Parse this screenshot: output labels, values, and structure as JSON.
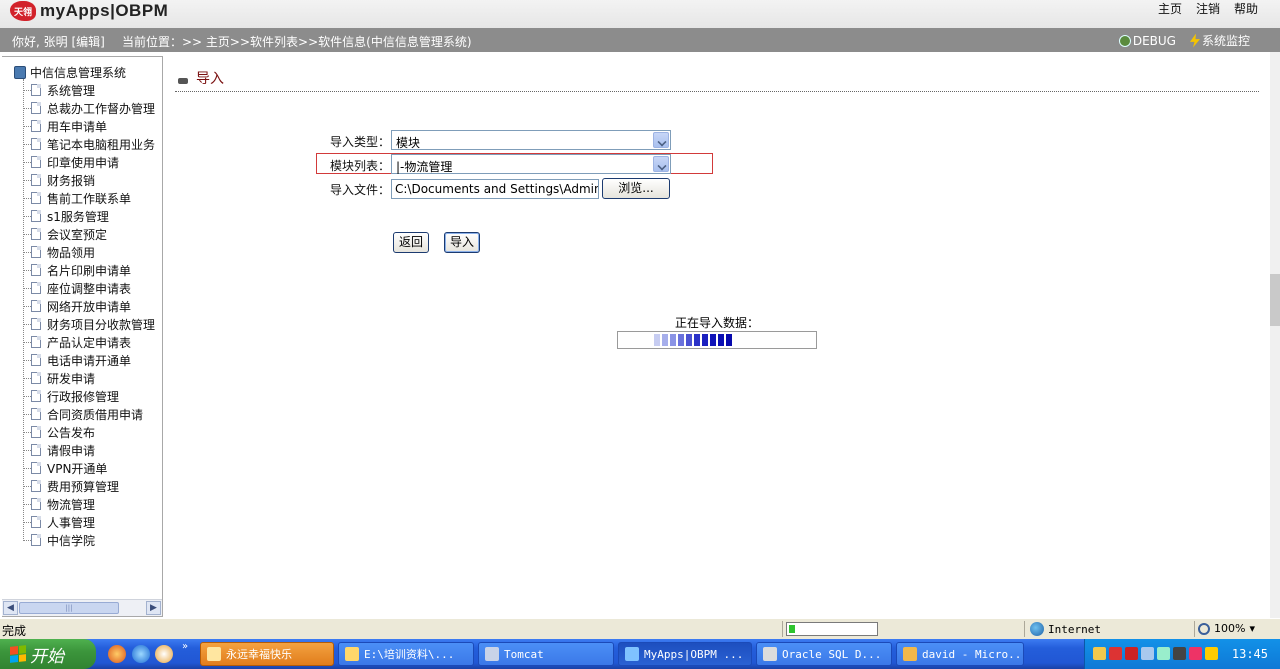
{
  "app": {
    "logo_mark": "天翎",
    "title": "myApps|OBPM",
    "top_links": [
      "主页",
      "注销",
      "帮助"
    ]
  },
  "infobar": {
    "greeting": "你好, 张明 [编辑]",
    "breadcrumb": "当前位置：>> 主页>>软件列表>>软件信息(中信信息管理系统)",
    "debug_label": "DEBUG",
    "monitor_label": "系统监控"
  },
  "sidebar": {
    "root": "中信信息管理系统",
    "items": [
      "系统管理",
      "总裁办工作督办管理",
      "用车申请单",
      "笔记本电脑租用业务",
      "印章使用申请",
      "财务报销",
      "售前工作联系单",
      "s1服务管理",
      "会议室预定",
      "物品领用",
      "名片印刷申请单",
      "座位调整申请表",
      "网络开放申请单",
      "财务项目分收款管理",
      "产品认定申请表",
      "电话申请开通单",
      "研发申请",
      "行政报修管理",
      "合同资质借用申请",
      "公告发布",
      "请假申请",
      "VPN开通单",
      "费用预算管理",
      "物流管理",
      "人事管理",
      "中信学院"
    ]
  },
  "main": {
    "title": "导入",
    "import_type_label": "导入类型：",
    "import_type_value": "模块",
    "module_list_label": "模块列表：",
    "module_list_value": "|-物流管理",
    "import_file_label": "导入文件：",
    "import_file_value": "C:\\Documents and Settings\\Admini",
    "browse_button": "浏览...",
    "back_button": "返回",
    "import_button": "导入",
    "progress_label": "正在导入数据：",
    "progress_colors": [
      "#c7cdf2",
      "#a6aeeb",
      "#8a93e5",
      "#6a72dc",
      "#4b52d2",
      "#2b32c8",
      "#1a1fbf",
      "#1014b9",
      "#0a0eb3",
      "#0709ad"
    ]
  },
  "statusbar": {
    "status": "完成",
    "zone": "Internet",
    "zoom": "100%"
  },
  "taskbar": {
    "start": "开始",
    "tasks": [
      {
        "label": "永远幸福快乐",
        "style": "orange"
      },
      {
        "label": "E:\\培训资料\\...",
        "style": "normal"
      },
      {
        "label": "Tomcat",
        "style": "normal"
      },
      {
        "label": "MyApps|OBPM ...",
        "style": "active"
      },
      {
        "label": "Oracle SQL D...",
        "style": "normal"
      },
      {
        "label": "david - Micro...",
        "style": "normal"
      }
    ],
    "clock": "13:45"
  }
}
